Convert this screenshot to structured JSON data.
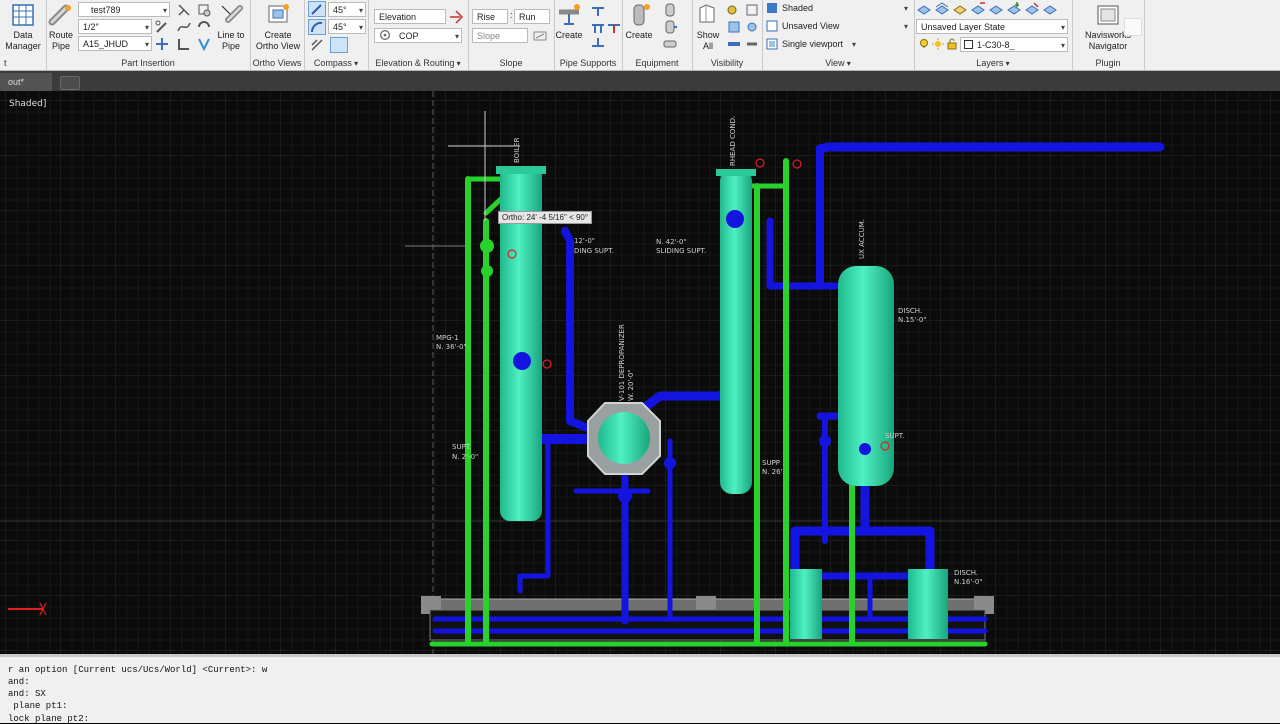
{
  "ribbon": {
    "home": {
      "data_manager": "Data\nManager",
      "label_partial": "t"
    },
    "part_insertion": {
      "route_pipe": "Route\nPipe",
      "spec": "test789",
      "size": "1/2\"",
      "tag": "A15_JHUD",
      "line_to_pipe": "Line to\nPipe",
      "label": "Part Insertion"
    },
    "ortho_views": {
      "create_ortho_view": "Create\nOrtho View",
      "label": "Ortho Views"
    },
    "compass": {
      "angle1": "45°",
      "angle2": "45°",
      "label": "Compass"
    },
    "elevation_routing": {
      "elevation_placeholder": "Elevation",
      "cop": "COP",
      "label": "Elevation & Routing"
    },
    "slope": {
      "rise": "Rise",
      "run": "Run",
      "slope_placeholder": "Slope",
      "label": "Slope"
    },
    "pipe_supports": {
      "create": "Create",
      "label": "Pipe Supports"
    },
    "equipment": {
      "create": "Create",
      "label": "Equipment"
    },
    "visibility": {
      "show_all": "Show\nAll",
      "label": "Visibility"
    },
    "view": {
      "visual_style": "Shaded",
      "saved_view": "Unsaved View",
      "viewport": "Single viewport",
      "label": "View"
    },
    "layers": {
      "layer_state": "Unsaved Layer State",
      "current_layer": "1-C30-8_",
      "label": "Layers"
    },
    "plugin": {
      "navisworks": "Navisworks\nNavigator",
      "label": "Plugin"
    }
  },
  "tabs": {
    "document": "out*"
  },
  "viewport": {
    "label": "Shaded]",
    "tooltip": "Ortho: 24' -4 5/16\" < 90°",
    "annotations": {
      "boiler": "BOILER",
      "overhead_cond": "RHEAD COND.",
      "depropanizer": "V-101 DEPROPANIZER",
      "depropanizer_el": "W. 20'-0\"",
      "accum": "UX ACCUM.",
      "n42": "N. 42'-0\"",
      "sliding_supt": "SLIDING SUPT.",
      "n42b": "12'-0\"",
      "ding_supt": "DING SUPT.",
      "mpg": "MPG-1",
      "mpg_el": "N. 36'-0\"",
      "supt": "SUPT.",
      "supt_el": "N. 2'-0\"",
      "supp": "SUPP",
      "supp_el": "N. 26'",
      "disch1": "DISCH.",
      "disch1_el": "N.15'-0\"",
      "disch2": "DISCH.",
      "disch2_el": "N.16'-0\"",
      "small_supt": "SUPT."
    }
  },
  "command_line": {
    "lines": [
      "r an option [Current ucs/Ucs/World] <Current>: w",
      "and:",
      "and: SX",
      " plane pt1:",
      "lock plane pt2:"
    ]
  },
  "colors": {
    "pipe_green": "#29d12c",
    "pipe_blue": "#1414e0",
    "vessel_cyan": "#36e6b4",
    "background": "#0b0b0b"
  }
}
